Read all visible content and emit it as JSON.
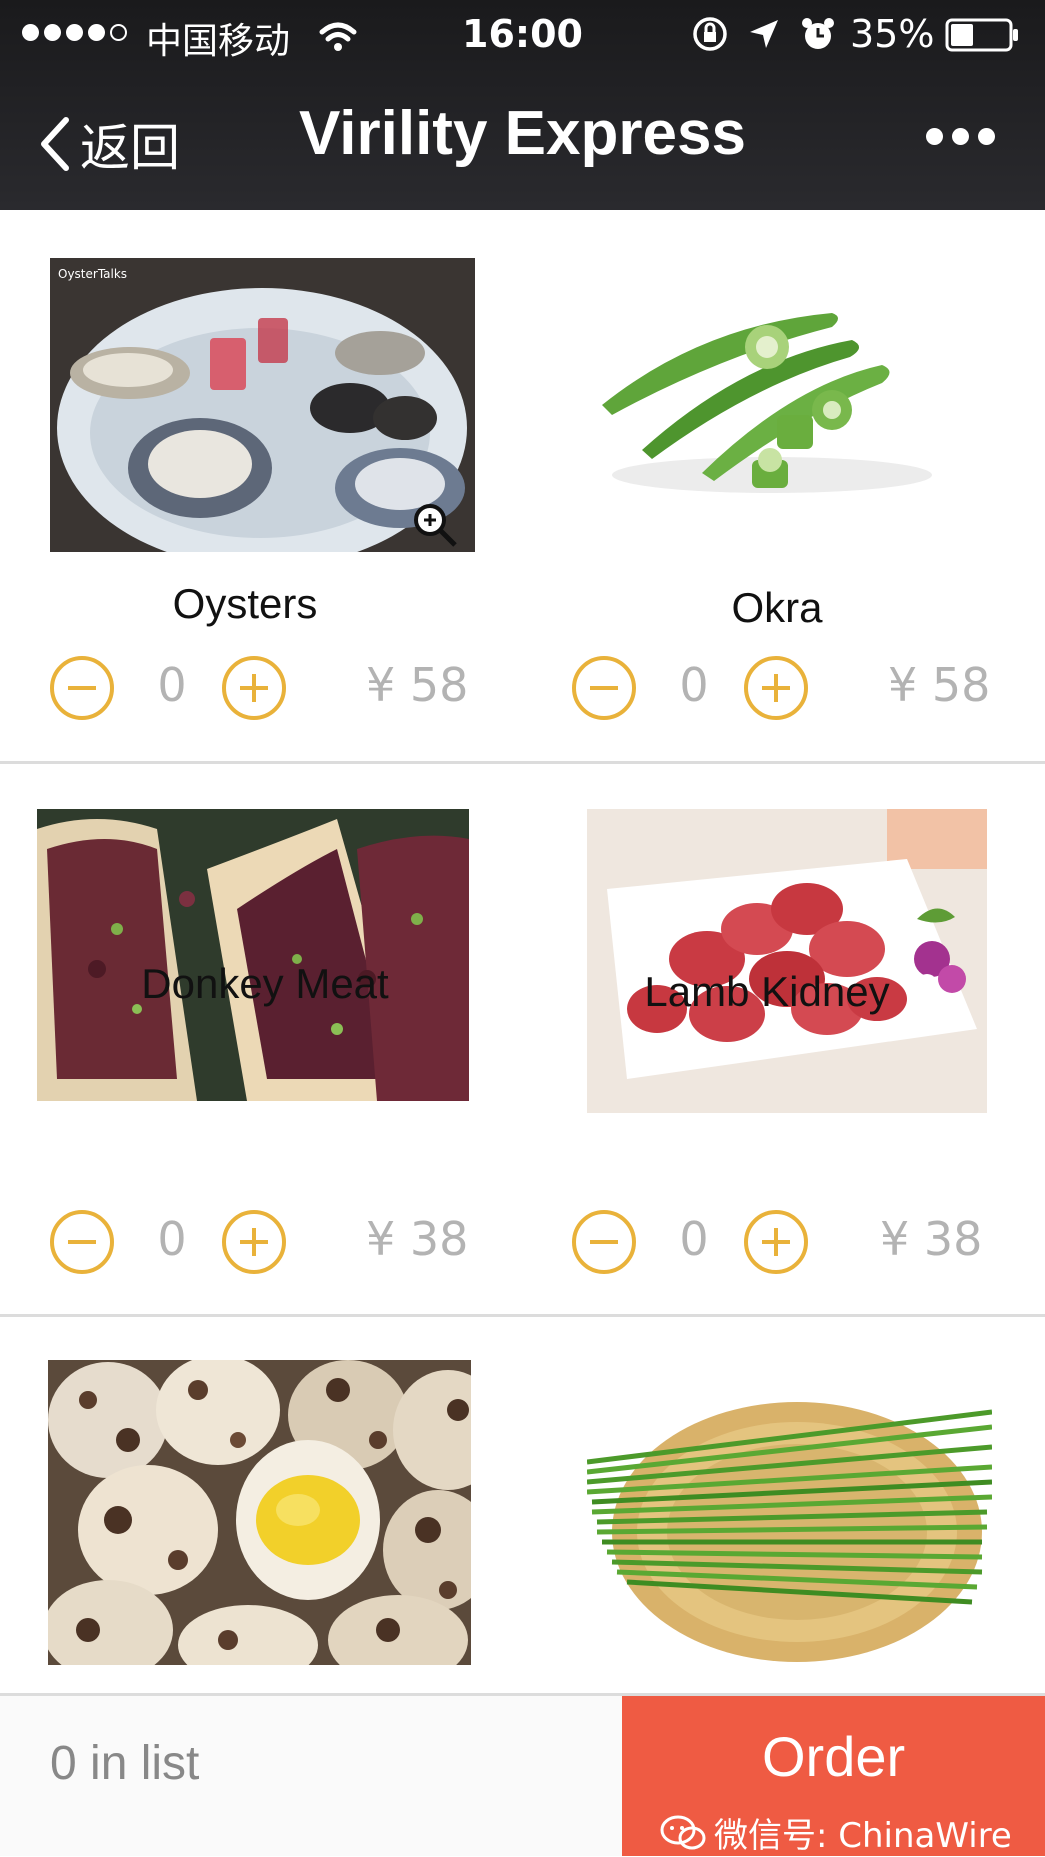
{
  "status_bar": {
    "carrier": "中国移动",
    "time": "16:00",
    "battery": "35%"
  },
  "nav": {
    "back_label": "返回",
    "title": "Virility Express"
  },
  "items": [
    {
      "name": "Oysters",
      "quantity": "0",
      "price": "¥ 58",
      "image": "oysters-photo",
      "image_caption": "OysterTalks"
    },
    {
      "name": "Okra",
      "quantity": "0",
      "price": "¥ 58",
      "image": "okra-photo"
    },
    {
      "name": "Donkey Meat",
      "quantity": "0",
      "price": "¥ 38",
      "image": "donkey-meat-photo"
    },
    {
      "name": "Lamb Kidney",
      "quantity": "0",
      "price": "¥ 38",
      "image": "lamb-kidney-photo"
    },
    {
      "name": "",
      "quantity": "",
      "price": "",
      "image": "quail-eggs-photo"
    },
    {
      "name": "",
      "quantity": "",
      "price": "",
      "image": "chives-photo"
    }
  ],
  "cart": {
    "summary": "0 in list",
    "order_label": "Order"
  },
  "watermark": "微信号: ChinaWire",
  "colors": {
    "accent": "#e9b23a",
    "order_button": "#ef5b43",
    "nav_bar": "#1a1a1c"
  }
}
